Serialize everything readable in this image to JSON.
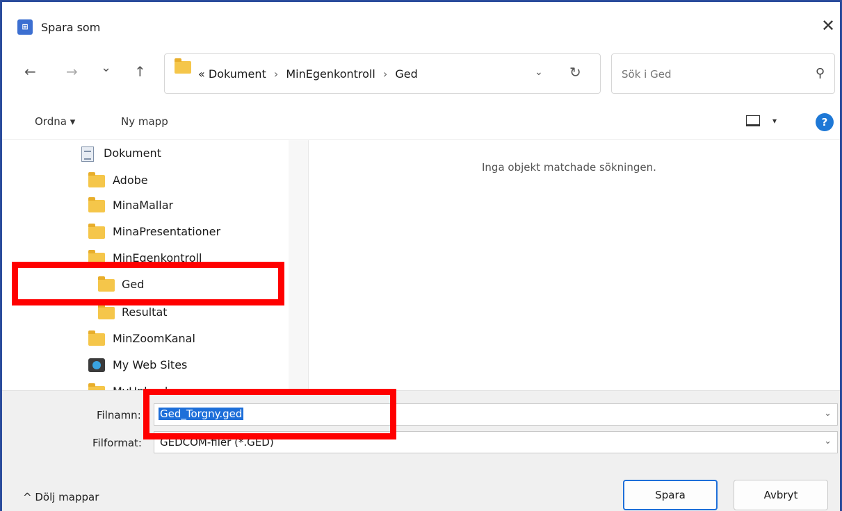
{
  "window": {
    "title": "Spara som",
    "icon": "app-icon",
    "close_glyph": "✕"
  },
  "nav": {
    "back_glyph": "←",
    "forward_glyph": "→",
    "recent_glyph": "⌄",
    "up_glyph": "↑",
    "address": {
      "overflow": "«",
      "crumbs": [
        "Dokument",
        "MinEgenkontroll",
        "Ged"
      ],
      "separator": "›",
      "dropdown_glyph": "⌄",
      "refresh_glyph": "↻"
    },
    "search": {
      "placeholder": "Sök i Ged",
      "icon_glyph": "⚲"
    }
  },
  "toolbar": {
    "organize": "Ordna ▾",
    "new_folder": "Ny mapp",
    "view_caret": "▾",
    "help": "?"
  },
  "tree": {
    "items": [
      {
        "label": "Dokument",
        "icon": "document-icon"
      },
      {
        "label": "Adobe",
        "icon": "folder-icon"
      },
      {
        "label": "MinaMallar",
        "icon": "folder-icon"
      },
      {
        "label": "MinaPresentationer",
        "icon": "folder-icon"
      },
      {
        "label": "MinEgenkontroll",
        "icon": "folder-icon"
      },
      {
        "label": "Ged",
        "icon": "folder-icon",
        "selected": true
      },
      {
        "label": "Resultat",
        "icon": "folder-icon"
      },
      {
        "label": "MinZoomKanal",
        "icon": "folder-icon"
      },
      {
        "label": "My Web Sites",
        "icon": "web-sites-icon"
      },
      {
        "label": "MyUploads",
        "icon": "folder-icon"
      }
    ]
  },
  "content": {
    "empty_message": "Inga objekt matchade sökningen."
  },
  "form": {
    "filename_label": "Filnamn:",
    "filename_value": "Ged_Torgny.ged",
    "format_label": "Filformat:",
    "format_value": "GEDCOM-filer (*.GED)",
    "dropdown_glyph": "⌄"
  },
  "footer": {
    "hide_folders": "^  Dölj mappar",
    "save": "Spara",
    "cancel": "Avbryt"
  },
  "colors": {
    "accent": "#1e6fd9",
    "highlight": "#ff0000",
    "folder": "#f5c64a",
    "border": "#2b4c9c"
  }
}
